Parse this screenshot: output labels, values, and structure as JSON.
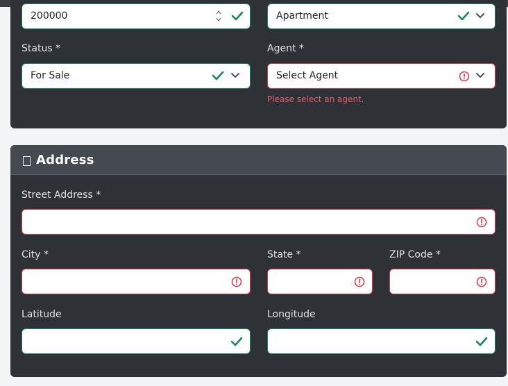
{
  "property": {
    "price_value": "200000",
    "type_value": "Apartment",
    "status_label": "Status *",
    "status_value": "For Sale",
    "agent_label": "Agent *",
    "agent_value": "Select Agent",
    "agent_error": "Please select an agent."
  },
  "address": {
    "title": "Address",
    "street_label": "Street Address *",
    "street_value": "",
    "city_label": "City *",
    "city_value": "",
    "state_label": "State *",
    "state_value": "",
    "zip_label": "ZIP Code *",
    "zip_value": "",
    "latitude_label": "Latitude",
    "latitude_value": "",
    "longitude_label": "Longitude",
    "longitude_value": ""
  },
  "colors": {
    "valid": "#198754",
    "invalid": "#dc3545",
    "card_bg": "#2e3136",
    "header_bg": "#454950"
  },
  "icons": {
    "valid": "check-icon",
    "invalid": "exclamation-circle-icon",
    "select": "chevron-down-icon",
    "spinner": "number-spinner-icon",
    "header": "address-icon"
  }
}
